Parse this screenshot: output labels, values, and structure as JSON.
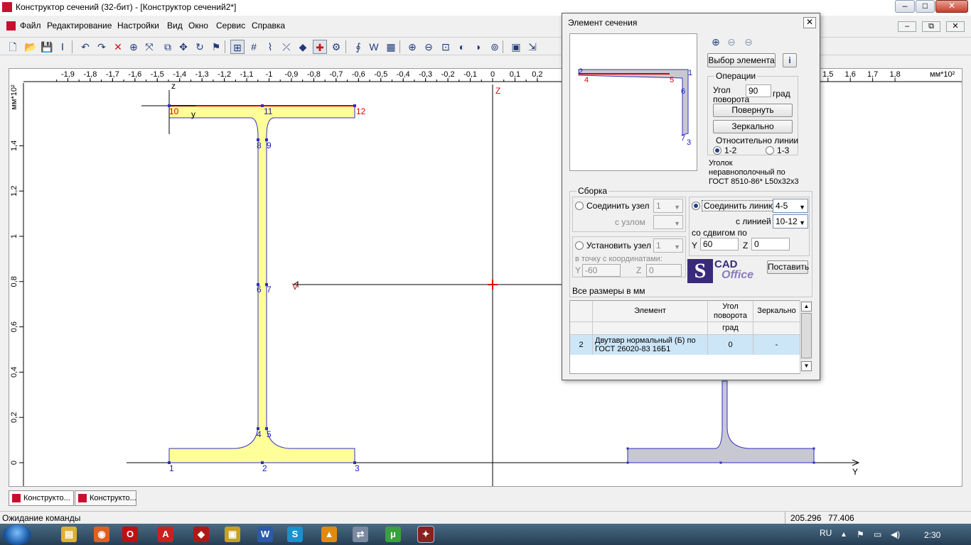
{
  "window": {
    "title": "Конструктор сечений (32-бит) - [Конструктор сечений2*]",
    "btn_min": "–",
    "btn_max": "□",
    "btn_close": "✕"
  },
  "menu": {
    "items": [
      "Файл",
      "Редактирование",
      "Настройки",
      "Вид",
      "Окно",
      "Сервис",
      "Справка"
    ],
    "mdi_min": "–",
    "mdi_restore": "⧉",
    "mdi_close": "✕"
  },
  "toolbar": {
    "icons": [
      "new-doc-icon",
      "open-folder-icon",
      "save-icon",
      "i-beam-icon",
      "undo-icon",
      "redo-icon",
      "delete-icon",
      "center-icon",
      "transform-icon",
      "copy-icon",
      "move-icon",
      "rotate-icon",
      "flag-icon",
      "select-icon",
      "grid-icon",
      "polyline-icon",
      "cross-icon",
      "point-icon",
      "crosshair-icon",
      "snap-icon",
      "phi-icon",
      "w-icon",
      "layers-icon",
      "zoom-in-icon",
      "zoom-out-icon",
      "zoom-window-icon",
      "zoom-prev-icon",
      "zoom-next-icon",
      "zoom-all-icon",
      "report-icon",
      "export-icon"
    ],
    "glyphs": [
      "🗋",
      "📂",
      "💾",
      "Ⅰ",
      "↶",
      "↷",
      "✕",
      "⊕",
      "⤧",
      "⧉",
      "✥",
      "↻",
      "⚑",
      "⊞",
      "#",
      "⌇",
      "⤫",
      "◆",
      "✚",
      "⚙",
      "∮",
      "W",
      "▦",
      "⊕",
      "⊖",
      "⊡",
      "◐",
      "◑",
      "⊚",
      "▣",
      "⇲"
    ]
  },
  "ruler": {
    "x_ticks": [
      "-1,9",
      "-1,8",
      "-1,7",
      "-1,6",
      "-1,5",
      "-1,4",
      "-1,3",
      "-1,2",
      "-1,1",
      "-1",
      "-0,9",
      "-0,8",
      "-0,7",
      "-0,6",
      "-0,5",
      "-0,4",
      "-0,3",
      "-0,2",
      "-0,1",
      "0",
      "0,1",
      "0,2",
      "1,5",
      "1,6",
      "1,7",
      "1,8"
    ],
    "x_unit": "мм*10²",
    "y_ticks": [
      "1,4",
      "1,2",
      "1",
      "0,8",
      "0,6",
      "0,4",
      "0,2",
      "0"
    ],
    "y_unit": "мм*10²"
  },
  "drawing": {
    "node_labels": [
      "1",
      "2",
      "3",
      "4",
      "5",
      "6",
      "7",
      "8",
      "9",
      "10",
      "11",
      "12"
    ],
    "local_axis_z": "z",
    "local_axis_y": "y",
    "global_axis_y": "Y",
    "global_axis_z": "Z",
    "marker_v": "V",
    "colors": {
      "section_fill": "#ffff99",
      "outline": "#3030c0",
      "second_fill": "#c8c8d2",
      "highlight": "#dd0000",
      "label": "#1a1ab8"
    }
  },
  "dialog": {
    "title": "Элемент сечения",
    "close": "✕",
    "select_element_button": "Выбор элемента",
    "info_icon": "i",
    "preview_labels": [
      "2",
      "4",
      "5",
      "1",
      "6",
      "7",
      "3"
    ],
    "operations": {
      "label": "Операции",
      "angle_label_line1": "Угол",
      "angle_label_line2": "поворота",
      "angle_value": "90",
      "angle_unit": "град",
      "rotate_button": "Повернуть",
      "mirror_button": "Зеркально",
      "relative_label": "Относительно линии",
      "radio_a": "1-2",
      "radio_b": "1-3"
    },
    "element_desc": [
      "Уголок",
      "неравнополочный по",
      "ГОСТ 8510-86* L50x32x3"
    ],
    "assembly": {
      "label": "Сборка",
      "join_node_label": "Соединить узел",
      "join_node_value": "1",
      "with_node_label": "с узлом",
      "with_node_value": "",
      "set_node_label": "Установить узел",
      "set_node_value": "1",
      "to_point_label": "в точку с координатами:",
      "y_label": "Y",
      "y_value": "-60",
      "z_label": "Z",
      "z_value": "0",
      "join_line_label": "Соединить линию",
      "join_line_value": "4-5",
      "with_line_label": "с линией",
      "with_line_value": "10-12",
      "shift_label": "со сдвигом по",
      "shift_y_label": "Y",
      "shift_y_value": "60",
      "shift_z_label": "Z",
      "shift_z_value": "0",
      "place_button": "Поставить"
    },
    "logo": {
      "big": "S",
      "cad": "CAD",
      "office": "Office"
    },
    "units_note": "Все размеры в мм",
    "table": {
      "headers": [
        "Элемент",
        "Угол поворота",
        "Зеркально"
      ],
      "units_row": [
        "",
        "град",
        ""
      ],
      "rows": [
        {
          "num": "2",
          "element": "Двутавр нормальный (Б) по ГОСТ 26020-83 16Б1",
          "angle": "0",
          "mirror": "-"
        }
      ]
    }
  },
  "tabs": [
    "Конструкто...",
    "Конструкто..."
  ],
  "status": {
    "text": "Ожидание команды",
    "coord_x": "205.296",
    "coord_y": "77.406"
  },
  "taskbar": {
    "lang": "RU",
    "clock": "2:30",
    "apps": [
      "windows-start-icon",
      "file-explorer-icon",
      "firefox-icon",
      "opera-icon",
      "acrobat-icon",
      "cad-red-icon",
      "archive-icon",
      "word-icon",
      "skype-icon",
      "avast-icon",
      "network-icon",
      "utorrent-icon",
      "section-constructor-icon"
    ]
  }
}
